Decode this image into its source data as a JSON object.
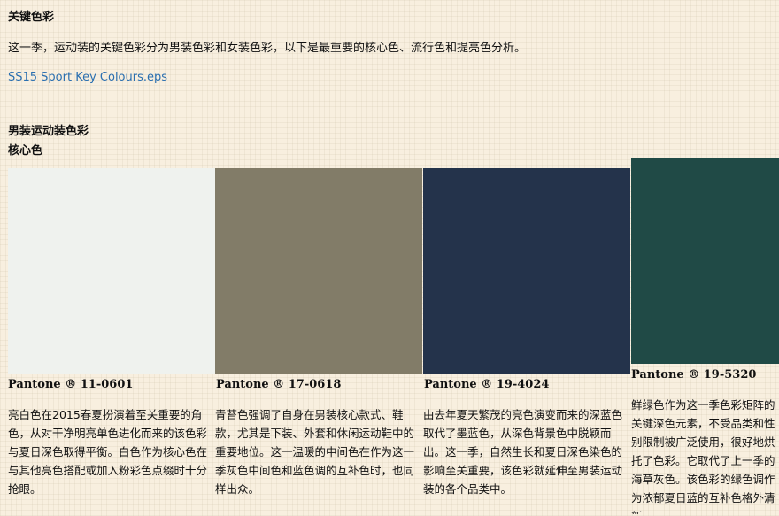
{
  "section": {
    "title": "关键色彩",
    "intro": "这一季，运动装的关键色彩分为男装色彩和女装色彩，以下是最重要的核心色、流行色和提亮色分析。",
    "file_link": "SS15 Sport Key Colours.eps",
    "subheading": "男装运动装色彩",
    "subsubheading": "核心色"
  },
  "swatches": [
    {
      "color": "#eff2ee",
      "pantone": "Pantone ® 11-0601",
      "description": "亮白色在2015春夏扮演着至关重要的角色，从对干净明亮单色进化而来的该色彩与夏日深色取得平衡。白色作为核心色在与其他亮色搭配或加入粉彩色点缀时十分抢眼。"
    },
    {
      "color": "#827c68",
      "pantone": "Pantone ® 17-0618",
      "description": "青苔色强调了自身在男装核心款式、鞋款，尤其是下装、外套和休闲运动鞋中的重要地位。这一温暖的中间色在作为这一季灰色中间色和蓝色调的互补色时，也同样出众。"
    },
    {
      "color": "#24334b",
      "pantone": "Pantone ® 19-4024",
      "description": "由去年夏天繁茂的亮色演变而来的深蓝色取代了墨蓝色，从深色背景色中脱颖而出。这一季，自然生长和夏日深色染色的影响至关重要，该色彩就延伸至男装运动装的各个品类中。"
    },
    {
      "color": "#204a46",
      "pantone": "Pantone ® 19-5320",
      "description": "鲜绿色作为这一季色彩矩阵的关键深色元素，不受品类和性别限制被广泛使用，很好地烘托了色彩。它取代了上一季的海草灰色。该色彩的绿色调作为浓郁夏日蓝的互补色格外清新。"
    }
  ]
}
